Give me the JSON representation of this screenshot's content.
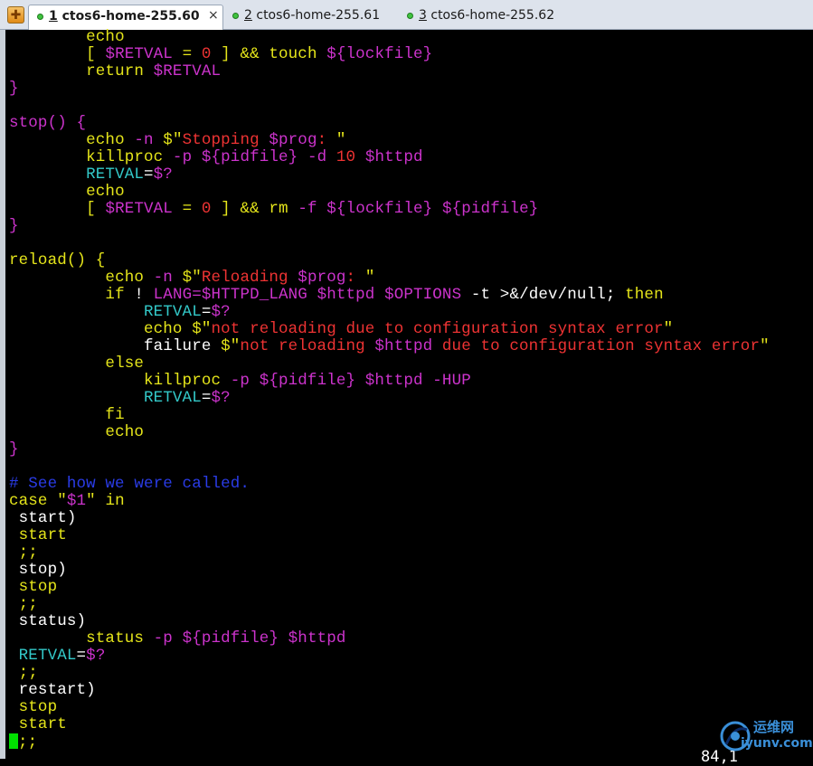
{
  "app": {
    "icon_glyph": "✚"
  },
  "tabs": [
    {
      "num": "1",
      "title": "ctos6-home-255.60",
      "active": true,
      "close": "×"
    },
    {
      "num": "2",
      "title": "ctos6-home-255.61",
      "active": false
    },
    {
      "num": "3",
      "title": "ctos6-home-255.62",
      "active": false
    }
  ],
  "terminal": {
    "lines": [
      [
        [
          "        ",
          "default"
        ],
        [
          "echo",
          "yellow"
        ]
      ],
      [
        [
          "        ",
          "default"
        ],
        [
          "[ ",
          "yellow"
        ],
        [
          "$RETVAL",
          "magenta"
        ],
        [
          " = ",
          "yellow"
        ],
        [
          "0",
          "red"
        ],
        [
          " ] && touch ",
          "yellow"
        ],
        [
          "${lockfile}",
          "magenta"
        ]
      ],
      [
        [
          "        ",
          "default"
        ],
        [
          "return ",
          "yellow"
        ],
        [
          "$RETVAL",
          "magenta"
        ]
      ],
      [
        [
          "}",
          "magenta"
        ]
      ],
      [
        [
          "",
          "default"
        ]
      ],
      [
        [
          "stop() {",
          "magenta"
        ]
      ],
      [
        [
          "        ",
          "default"
        ],
        [
          "echo ",
          "yellow"
        ],
        [
          "-n",
          "magenta"
        ],
        [
          " $\"",
          "yellow"
        ],
        [
          "Stopping ",
          "red"
        ],
        [
          "$prog",
          "magenta"
        ],
        [
          ": ",
          "red"
        ],
        [
          "\"",
          "yellow"
        ]
      ],
      [
        [
          "        ",
          "default"
        ],
        [
          "killproc ",
          "yellow"
        ],
        [
          "-p",
          "magenta"
        ],
        [
          " ",
          "default"
        ],
        [
          "${pidfile}",
          "magenta"
        ],
        [
          " -d ",
          "magenta"
        ],
        [
          "10",
          "red"
        ],
        [
          " $httpd",
          "magenta"
        ]
      ],
      [
        [
          "        ",
          "default"
        ],
        [
          "RETVAL",
          "cyan"
        ],
        [
          "=",
          "default"
        ],
        [
          "$?",
          "magenta"
        ]
      ],
      [
        [
          "        ",
          "default"
        ],
        [
          "echo",
          "yellow"
        ]
      ],
      [
        [
          "        ",
          "default"
        ],
        [
          "[ ",
          "yellow"
        ],
        [
          "$RETVAL",
          "magenta"
        ],
        [
          " = ",
          "yellow"
        ],
        [
          "0",
          "red"
        ],
        [
          " ] && rm ",
          "yellow"
        ],
        [
          "-f",
          "magenta"
        ],
        [
          " ",
          "default"
        ],
        [
          "${lockfile}",
          "magenta"
        ],
        [
          " ",
          "default"
        ],
        [
          "${pidfile}",
          "magenta"
        ]
      ],
      [
        [
          "}",
          "magenta"
        ]
      ],
      [
        [
          "",
          "default"
        ]
      ],
      [
        [
          "reload() {",
          "yellow"
        ]
      ],
      [
        [
          "          ",
          "default"
        ],
        [
          "echo ",
          "yellow"
        ],
        [
          "-n",
          "magenta"
        ],
        [
          " $\"",
          "yellow"
        ],
        [
          "Reloading ",
          "red"
        ],
        [
          "$prog",
          "magenta"
        ],
        [
          ": ",
          "red"
        ],
        [
          "\"",
          "yellow"
        ]
      ],
      [
        [
          "          ",
          "default"
        ],
        [
          "if",
          "yellow"
        ],
        [
          " ! ",
          "default"
        ],
        [
          "LANG=",
          "magenta"
        ],
        [
          "$HTTPD_LANG",
          "magenta"
        ],
        [
          " $httpd ",
          "magenta"
        ],
        [
          "$OPTIONS",
          "magenta"
        ],
        [
          " -t ",
          "default"
        ],
        [
          ">&/dev/null; ",
          "default"
        ],
        [
          "then",
          "yellow"
        ]
      ],
      [
        [
          "              ",
          "default"
        ],
        [
          "RETVAL",
          "cyan"
        ],
        [
          "=",
          "default"
        ],
        [
          "$?",
          "magenta"
        ]
      ],
      [
        [
          "              ",
          "default"
        ],
        [
          "echo ",
          "yellow"
        ],
        [
          "$\"",
          "yellow"
        ],
        [
          "not reloading due to configuration syntax error",
          "red"
        ],
        [
          "\"",
          "yellow"
        ]
      ],
      [
        [
          "              ",
          "default"
        ],
        [
          "failure ",
          "default"
        ],
        [
          "$\"",
          "yellow"
        ],
        [
          "not reloading ",
          "red"
        ],
        [
          "$httpd",
          "magenta"
        ],
        [
          " due to configuration syntax error",
          "red"
        ],
        [
          "\"",
          "yellow"
        ]
      ],
      [
        [
          "          ",
          "default"
        ],
        [
          "else",
          "yellow"
        ]
      ],
      [
        [
          "              ",
          "default"
        ],
        [
          "killproc ",
          "yellow"
        ],
        [
          "-p",
          "magenta"
        ],
        [
          " ",
          "default"
        ],
        [
          "${pidfile}",
          "magenta"
        ],
        [
          " $httpd ",
          "magenta"
        ],
        [
          "-HUP",
          "magenta"
        ]
      ],
      [
        [
          "              ",
          "default"
        ],
        [
          "RETVAL",
          "cyan"
        ],
        [
          "=",
          "default"
        ],
        [
          "$?",
          "magenta"
        ]
      ],
      [
        [
          "          ",
          "default"
        ],
        [
          "fi",
          "yellow"
        ]
      ],
      [
        [
          "          ",
          "default"
        ],
        [
          "echo",
          "yellow"
        ]
      ],
      [
        [
          "}",
          "magenta"
        ]
      ],
      [
        [
          "",
          "default"
        ]
      ],
      [
        [
          "# See how we were called.",
          "blue"
        ]
      ],
      [
        [
          "case ",
          "yellow"
        ],
        [
          "\"",
          "yellow"
        ],
        [
          "$1",
          "magenta"
        ],
        [
          "\"",
          "yellow"
        ],
        [
          " in",
          "yellow"
        ]
      ],
      [
        [
          " start)",
          "default"
        ]
      ],
      [
        [
          " start",
          "yellow"
        ]
      ],
      [
        [
          " ;;",
          "yellow"
        ]
      ],
      [
        [
          " stop)",
          "default"
        ]
      ],
      [
        [
          " stop",
          "yellow"
        ]
      ],
      [
        [
          " ;;",
          "yellow"
        ]
      ],
      [
        [
          " status)",
          "default"
        ]
      ],
      [
        [
          "        ",
          "default"
        ],
        [
          "status ",
          "yellow"
        ],
        [
          "-p",
          "magenta"
        ],
        [
          " ",
          "default"
        ],
        [
          "${pidfile}",
          "magenta"
        ],
        [
          " $httpd",
          "magenta"
        ]
      ],
      [
        [
          " ",
          "default"
        ],
        [
          "RETVAL",
          "cyan"
        ],
        [
          "=",
          "default"
        ],
        [
          "$?",
          "magenta"
        ]
      ],
      [
        [
          " ;;",
          "yellow"
        ]
      ],
      [
        [
          " restart)",
          "default"
        ]
      ],
      [
        [
          " stop",
          "yellow"
        ]
      ],
      [
        [
          " start",
          "yellow"
        ]
      ],
      [
        [
          ";;",
          "yellow"
        ]
      ]
    ],
    "cursor_line": 41,
    "ruler": "84,1"
  },
  "watermark": {
    "cn": "运维网",
    "url": "iyunv.com"
  },
  "colors": {
    "background": "#000000",
    "yellow": "#e5e51a",
    "magenta": "#cc33cc",
    "red": "#ee3333",
    "cyan": "#33c9c9",
    "blue": "#2a3ce8",
    "cursor": "#00e000"
  }
}
